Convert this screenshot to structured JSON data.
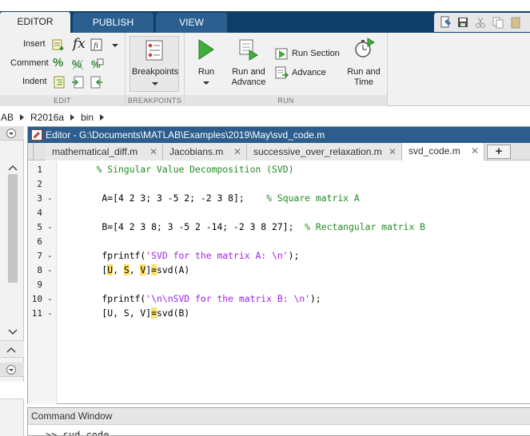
{
  "tabs": [
    {
      "label": "EDITOR",
      "active": true
    },
    {
      "label": "PUBLISH",
      "active": false
    },
    {
      "label": "VIEW",
      "active": false
    }
  ],
  "ribbon": {
    "edit": {
      "insert_label": "Insert",
      "comment_label": "Comment",
      "indent_label": "Indent",
      "fx_label": "fx",
      "comment_pct": "%",
      "section_label": "EDIT"
    },
    "breakpoints": {
      "button_label": "Breakpoints",
      "section_label": "BREAKPOINTS"
    },
    "run": {
      "run_label": "Run",
      "run_advance_label_1": "Run and",
      "run_advance_label_2": "Advance",
      "run_section_label": "Run Section",
      "advance_label": "Advance",
      "run_time_label_1": "Run and",
      "run_time_label_2": "Time",
      "section_label": "RUN"
    }
  },
  "breadcrumb": [
    "AB",
    "R2016a",
    "bin"
  ],
  "editor": {
    "title": "Editor - G:\\Documents\\MATLAB\\Examples\\2019\\May\\svd_code.m",
    "files": [
      {
        "name": "mathematical_diff.m",
        "active": false
      },
      {
        "name": "Jacobians.m",
        "active": false
      },
      {
        "name": "successive_over_relaxation.m",
        "active": false
      },
      {
        "name": "svd_code.m",
        "active": true
      }
    ],
    "close_glyph": "✕",
    "add_tab": "+",
    "lines": [
      {
        "num": "1",
        "dash": "",
        "code": "   % Singular Value Decomposition (SVD)"
      },
      {
        "num": "2",
        "dash": "",
        "code": ""
      },
      {
        "num": "3",
        "dash": "-",
        "code": "    A=[4 2 3; 3 -5 2; -2 3 8];    % Square matrix A"
      },
      {
        "num": "4",
        "dash": "",
        "code": ""
      },
      {
        "num": "5",
        "dash": "-",
        "code": "    B=[4 2 3 8; 3 -5 2 -14; -2 3 8 27];  % Rectangular matrix B"
      },
      {
        "num": "6",
        "dash": "",
        "code": ""
      },
      {
        "num": "7",
        "dash": "-",
        "code": "    fprintf('SVD for the matrix A: \\n');"
      },
      {
        "num": "8",
        "dash": "-",
        "code": "    [U, S, V]=svd(A)"
      },
      {
        "num": "9",
        "dash": "",
        "code": ""
      },
      {
        "num": "10",
        "dash": "-",
        "code": "    fprintf('\\n\\nSVD for the matrix B: \\n');"
      },
      {
        "num": "11",
        "dash": "-",
        "code": "    [U, S, V]=svd(B)"
      }
    ]
  },
  "command_window": {
    "title": "Command Window",
    "prompt": ">> svd_code"
  }
}
